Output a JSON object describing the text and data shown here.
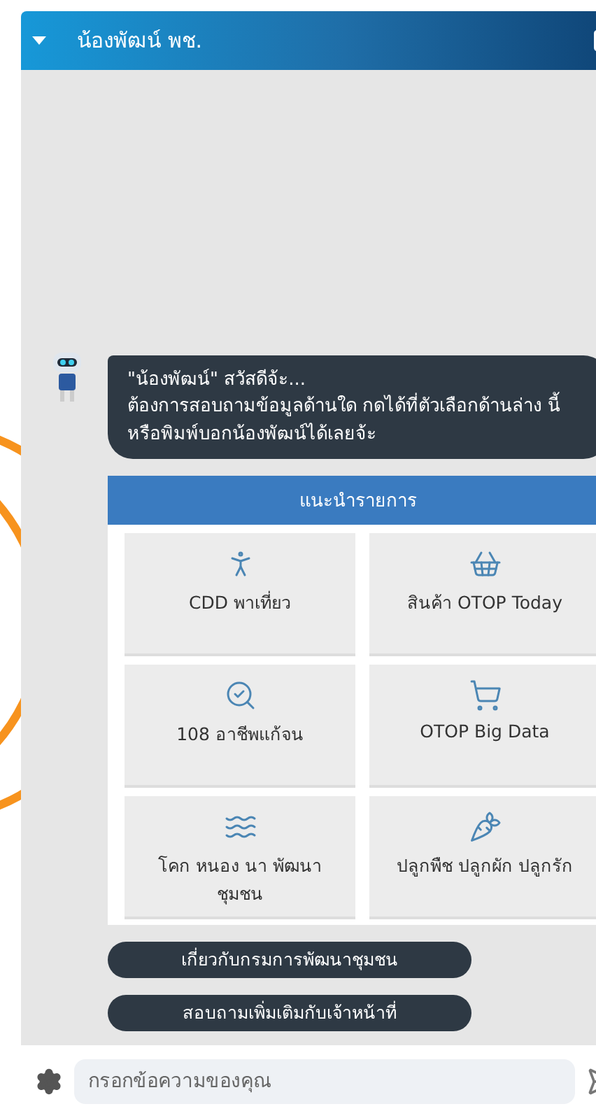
{
  "header": {
    "title": "น้องพัฒน์ พช."
  },
  "message": {
    "greeting": "\"น้องพัฒน์\" สวัสดีจ้ะ...",
    "body": "ต้องการสอบถามข้อมูลด้านใด กดได้ที่ตัวเลือกด้านล่าง นี้ หรือพิมพ์บอกน้องพัฒน์ได้เลยจ้ะ"
  },
  "menu": {
    "title": "แนะนำรายการ",
    "items": [
      {
        "label": "CDD พาเที่ยว"
      },
      {
        "label": "สินค้า OTOP Today"
      },
      {
        "label": "108 อาชีพแก้จน"
      },
      {
        "label": "OTOP Big Data"
      },
      {
        "label": "โคก หนอง นา พัฒนา ชุมชน"
      },
      {
        "label": "ปลูกพืช ปลูกผัก ปลูกรัก"
      }
    ]
  },
  "quick_replies": [
    "เกี่ยวกับกรมการพัฒนาชุมชน",
    "สอบถามเพิ่มเติมกับเจ้าหน้าที่"
  ],
  "input": {
    "placeholder": "กรอกข้อความของคุณ"
  }
}
